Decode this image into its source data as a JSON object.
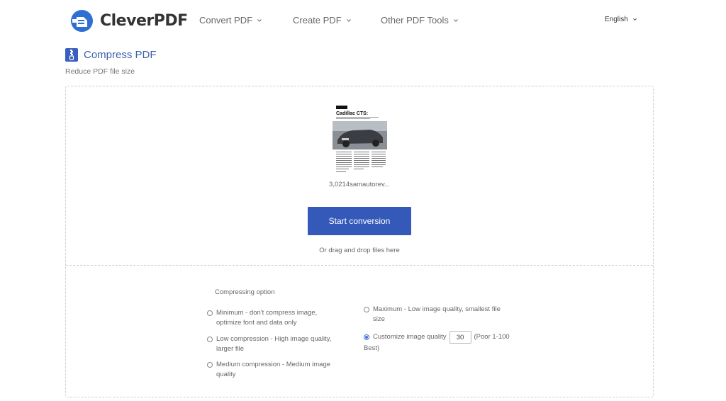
{
  "header": {
    "logo_text": "CleverPDF",
    "nav": [
      {
        "label": "Convert PDF"
      },
      {
        "label": "Create PDF"
      },
      {
        "label": "Other PDF Tools"
      }
    ],
    "language": "English"
  },
  "tool": {
    "title": "Compress PDF",
    "subtitle": "Reduce PDF file size"
  },
  "upload": {
    "file_name": "3,0214samautorev...",
    "thumbnail_heading": "Cadillac CTS:",
    "start_button": "Start conversion",
    "drag_text": "Or drag and drop files here"
  },
  "options": {
    "title": "Compressing option",
    "minimum": "Minimum - don't compress image, optimize font and data only",
    "low": "Low compression - High image quality, larger file",
    "medium": "Medium compression - Medium image quality",
    "maximum": "Maximum - Low image quality, smallest file size",
    "custom_label": "Customize image quality",
    "custom_value": "30",
    "custom_hint": "(Poor 1-100 Best)",
    "selected": "custom"
  },
  "colors": {
    "brand": "#3459b9",
    "title": "#3c5fae",
    "radio_selected": "#3b6fd6"
  }
}
